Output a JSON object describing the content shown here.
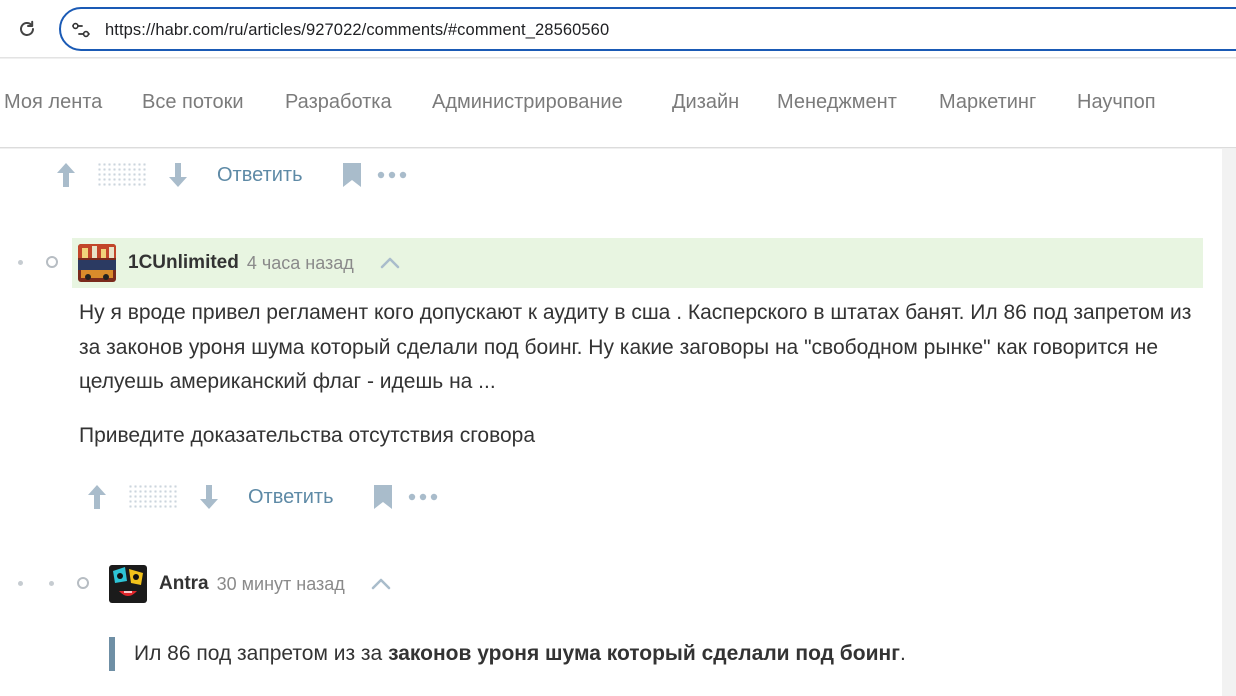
{
  "browser": {
    "url": "https://habr.com/ru/articles/927022/comments/#comment_28560560"
  },
  "nav": {
    "items": [
      "Моя лента",
      "Все потоки",
      "Разработка",
      "Администрирование",
      "Дизайн",
      "Менеджмент",
      "Маркетинг",
      "Научпоп"
    ]
  },
  "comments": [
    {
      "reply_label": "Ответить"
    },
    {
      "author": "1CUnlimited",
      "time": "4 часа назад",
      "paragraphs": [
        "Ну я вроде привел регламент кого допускают к аудиту в сша . Касперского в штатах банят. Ил 86 под запретом из за законов уроня шума который сделали под боинг. Ну какие заговоры на \"свободном рынке\" как говорится не целуешь американский флаг - идешь на ...",
        "Приведите доказательства отсутствия сговора"
      ],
      "reply_label": "Ответить",
      "highlight_color": "#e8f5e1"
    },
    {
      "author": "Antra",
      "time": "30 минут назад",
      "quote_plain": "Ил 86 под запретом из за ",
      "quote_bold": "законов уроня шума который сделали под боинг",
      "quote_tail": "."
    }
  ],
  "colors": {
    "accent": "#5e8aa6",
    "url_focus": "#1a5ab5",
    "icon": "#a9bccb"
  }
}
